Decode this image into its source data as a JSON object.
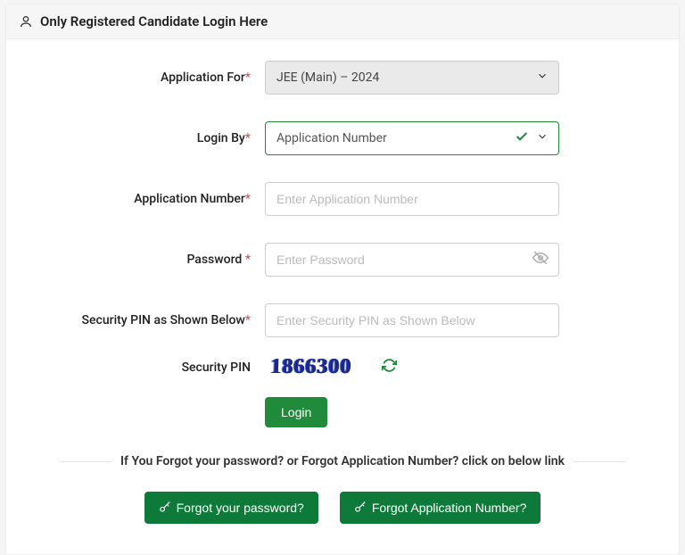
{
  "header": {
    "title": "Only Registered Candidate Login Here"
  },
  "form": {
    "application_for": {
      "label": "Application For",
      "value": "JEE (Main) – 2024"
    },
    "login_by": {
      "label": "Login By",
      "value": "Application Number"
    },
    "application_number": {
      "label": "Application Number",
      "placeholder": "Enter Application Number"
    },
    "password": {
      "label": "Password ",
      "placeholder": "Enter Password"
    },
    "security_pin_input": {
      "label": "Security PIN as Shown Below",
      "placeholder": "Enter Security PIN as Shown Below"
    },
    "security_pin": {
      "label": "Security PIN",
      "captcha_value": "1866300"
    },
    "login_button": "Login"
  },
  "footer": {
    "help_text": "If You Forgot your password? or Forgot Application Number? click on below link",
    "forgot_password": "Forgot your password?",
    "forgot_app_number": "Forgot Application Number?"
  }
}
